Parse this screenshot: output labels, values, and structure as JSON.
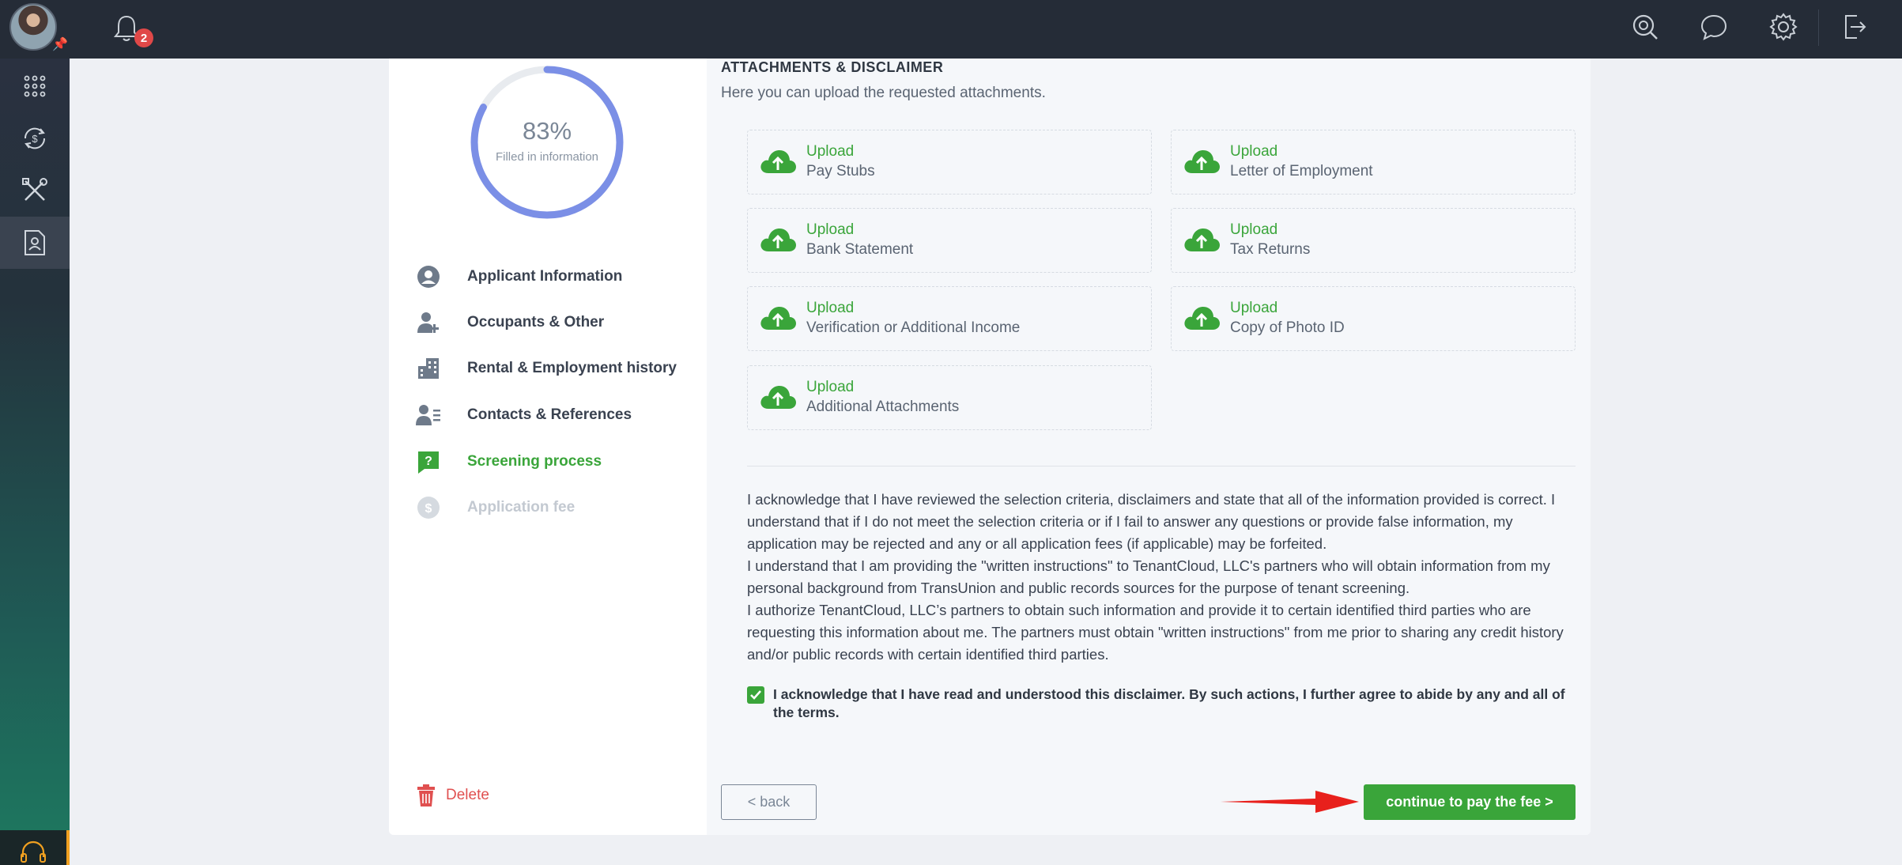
{
  "topbar": {
    "notifications_count": "2",
    "icons": [
      "search-icon",
      "chat-icon",
      "gear-icon",
      "logout-icon"
    ]
  },
  "rail": {
    "items": [
      "apps-grid-icon",
      "money-cycle-icon",
      "tools-icon",
      "profile-document-icon"
    ],
    "active": "profile-document-icon"
  },
  "progress": {
    "percent_label": "83%",
    "fraction": 0.83,
    "caption": "Filled in information"
  },
  "steps": [
    {
      "label": "Applicant Information",
      "icon": "user-circle-icon",
      "state": "done"
    },
    {
      "label": "Occupants & Other",
      "icon": "user-plus-icon",
      "state": "done"
    },
    {
      "label": "Rental & Employment history",
      "icon": "building-icon",
      "state": "done"
    },
    {
      "label": "Contacts & References",
      "icon": "contacts-icon",
      "state": "done"
    },
    {
      "label": "Screening process",
      "icon": "question-flag-icon",
      "state": "current"
    },
    {
      "label": "Application fee",
      "icon": "dollar-circle-icon",
      "state": "pending"
    }
  ],
  "delete_label": "Delete",
  "attachments": {
    "title": "ATTACHMENTS & DISCLAIMER",
    "subtitle": "Here you can upload the requested attachments.",
    "upload_label": "Upload",
    "items": [
      "Pay Stubs",
      "Letter of Employment",
      "Bank Statement",
      "Tax Returns",
      "Verification or Additional Income",
      "Copy of Photo ID",
      "Additional Attachments"
    ]
  },
  "disclaimer": {
    "p1": "I acknowledge that I have reviewed the selection criteria, disclaimers and state that all of the information provided is correct. I understand that if I do not meet the selection criteria or if I fail to answer any questions or provide false information, my application may be rejected and any or all application fees (if applicable) may be forfeited.",
    "p2": "I understand that I am providing the \"written instructions\" to TenantCloud, LLC's partners who will obtain information from my personal background from TransUnion and public records sources for the purpose of tenant screening.",
    "p3": "I authorize TenantCloud, LLC’s partners to obtain such information and provide it to certain identified third parties who are requesting this information about me. The partners must obtain \"written instructions\" from me prior to sharing any credit history and/or public records with certain identified third parties.",
    "agree_checked": true,
    "agree_label": "I acknowledge that I have read and understood this disclaimer. By such actions, I further agree to abide by any and all of the terms."
  },
  "buttons": {
    "back": "< back",
    "continue": "continue to pay the fee >"
  },
  "colors": {
    "accent_green": "#3aa53a",
    "topbar": "#252c37",
    "ring": "#7b8fe6",
    "delete": "#e05050",
    "arrow": "#e8201c"
  }
}
